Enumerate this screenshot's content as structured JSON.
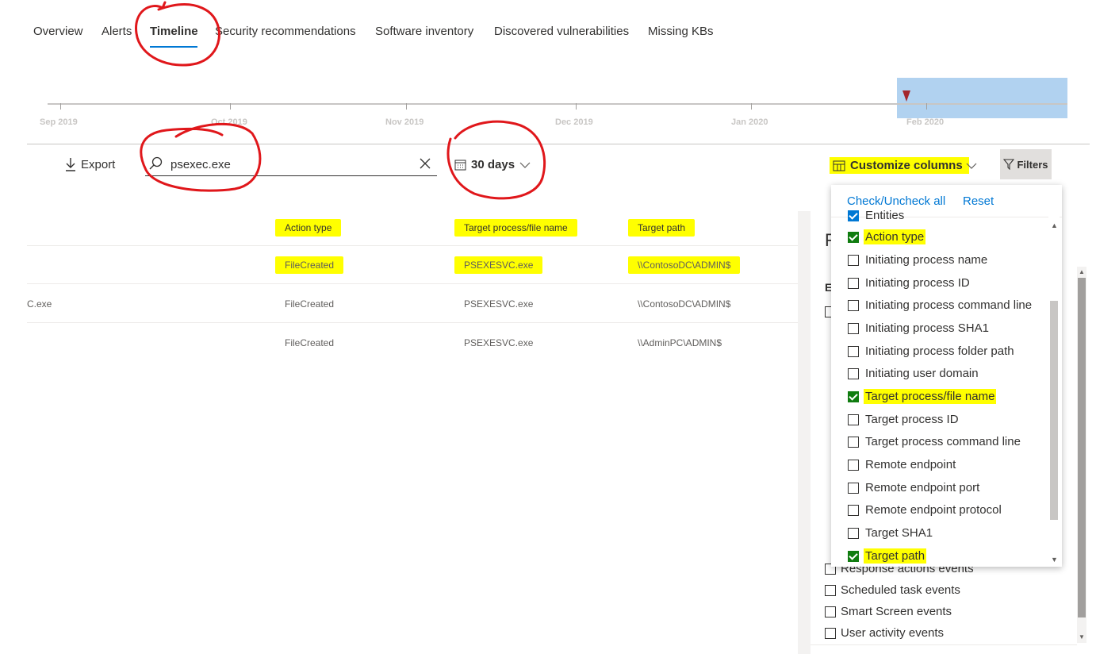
{
  "tabs": [
    {
      "label": "Overview"
    },
    {
      "label": "Alerts"
    },
    {
      "label": "Timeline"
    },
    {
      "label": "Security recommendations"
    },
    {
      "label": "Software inventory"
    },
    {
      "label": "Discovered vulnerabilities"
    },
    {
      "label": "Missing KBs"
    }
  ],
  "timeline": {
    "months": [
      "Sep 2019",
      "Oct 2019",
      "Nov 2019",
      "Dec 2019",
      "Jan 2020",
      "Feb 2020"
    ]
  },
  "toolbar": {
    "export_label": "Export",
    "search_value": "psexec.exe",
    "range_label": "30 days",
    "customize_label": "Customize columns",
    "filters_label": "Filters"
  },
  "table": {
    "headers": [
      "Action type",
      "Target process/file name",
      "Target path"
    ],
    "rows": [
      {
        "first": "",
        "action": "FileCreated",
        "target": "PSEXESVC.exe",
        "path": "\\\\ContosoDC\\ADMIN$"
      },
      {
        "first": "C.exe",
        "action": "FileCreated",
        "target": "PSEXESVC.exe",
        "path": "\\\\ContosoDC\\ADMIN$"
      },
      {
        "first": "",
        "action": "FileCreated",
        "target": "PSEXESVC.exe",
        "path": "\\\\AdminPC\\ADMIN$"
      }
    ]
  },
  "filter_panel": {
    "title_partial": "F",
    "section_partial": "E",
    "items": [
      "Response actions events",
      "Scheduled task events",
      "Smart Screen events",
      "User activity events"
    ]
  },
  "columns_dropdown": {
    "check_all_label": "Check/Uncheck all",
    "reset_label": "Reset",
    "partial_top_label": "Entities",
    "items": [
      {
        "label": "Action type",
        "checked": true
      },
      {
        "label": "Initiating process name",
        "checked": false
      },
      {
        "label": "Initiating process ID",
        "checked": false
      },
      {
        "label": "Initiating process command line",
        "checked": false
      },
      {
        "label": "Initiating process SHA1",
        "checked": false
      },
      {
        "label": "Initiating process folder path",
        "checked": false
      },
      {
        "label": "Initiating user domain",
        "checked": false
      },
      {
        "label": "Target process/file name",
        "checked": true
      },
      {
        "label": "Target process ID",
        "checked": false
      },
      {
        "label": "Target process command line",
        "checked": false
      },
      {
        "label": "Remote endpoint",
        "checked": false
      },
      {
        "label": "Remote endpoint port",
        "checked": false
      },
      {
        "label": "Remote endpoint protocol",
        "checked": false
      },
      {
        "label": "Target SHA1",
        "checked": false
      },
      {
        "label": "Target path",
        "checked": true
      }
    ]
  },
  "colors": {
    "accent": "#0078d4",
    "highlight": "#ffff00",
    "annotation": "#e0171b",
    "selection": "#a9cdee"
  }
}
